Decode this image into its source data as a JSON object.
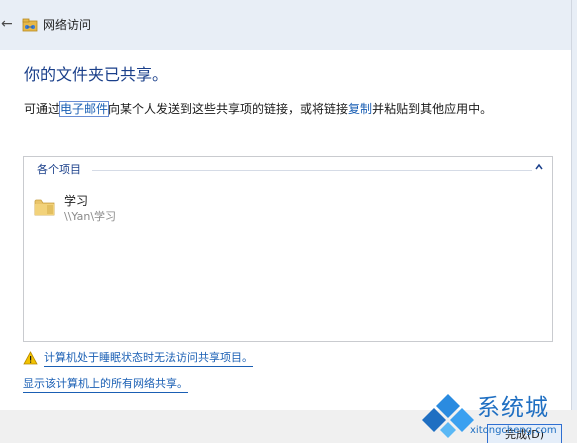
{
  "window": {
    "title": "网络访问",
    "icon": "network-share-icon",
    "back_icon": "←"
  },
  "main": {
    "heading": "你的文件夹已共享。",
    "description": {
      "prefix": "可通过",
      "email_link": "电子邮件",
      "middle": "向某个人发送到这些共享项的链接，或将链接",
      "copy_link": "复制",
      "suffix": "并粘贴到其他应用中。"
    }
  },
  "items_panel": {
    "header": "各个项目",
    "items": [
      {
        "name": "学习",
        "path": "\\\\Yan\\学习",
        "icon": "folder-icon"
      }
    ]
  },
  "warnings": {
    "sleep_warning": "计算机处于睡眠状态时无法访问共享项目。",
    "show_all": "显示该计算机上的所有网络共享。"
  },
  "footer": {
    "done_label": "完成(D)"
  },
  "watermark": {
    "name": "系统城",
    "domain": "xitongcheng.com"
  },
  "colors": {
    "heading": "#1a3f8a",
    "link": "#1a5fb4",
    "titlebar": "#e8eef6",
    "warning": "#f2c200"
  }
}
